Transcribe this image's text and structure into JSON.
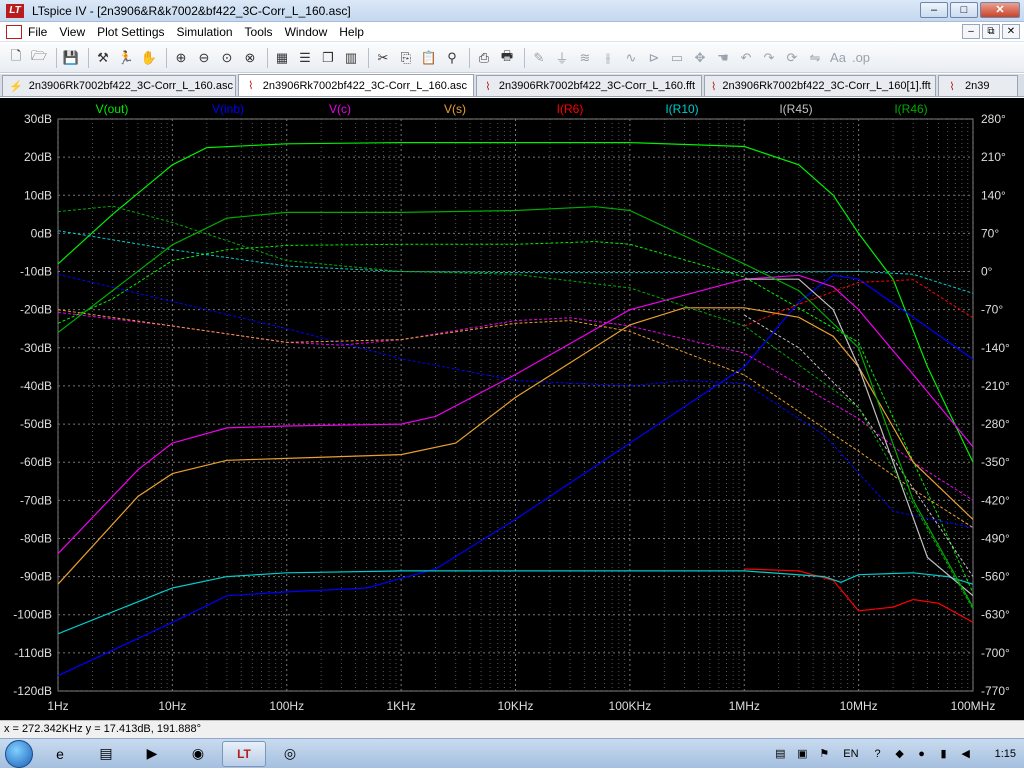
{
  "window": {
    "app_name": "LTspice IV",
    "document": "[2n3906&R&k7002&bf422_3C-Corr_L_160.asc]",
    "logo_text": "LT",
    "minimize": "–",
    "maximize": "□",
    "close": "✕"
  },
  "menu": {
    "items": [
      "File",
      "View",
      "Plot Settings",
      "Simulation",
      "Tools",
      "Window",
      "Help"
    ],
    "mdi_min": "–",
    "mdi_restore": "⧉",
    "mdi_close": "✕"
  },
  "toolbar": {
    "icons": [
      "open-icon",
      "open-folder-icon",
      "save-icon",
      "control-panel-icon",
      "run-icon",
      "halt-icon",
      "zoom-in-icon",
      "zoom-out-icon",
      "zoom-fit-icon",
      "zoom-cancel-icon",
      "autorange-icon",
      "tile-horizontal-icon",
      "cascade-icon",
      "tile-vertical-icon",
      "cut-icon",
      "copy-icon",
      "paste-icon",
      "find-icon",
      "print-setup-icon",
      "print-icon",
      "draw-wire-icon",
      "ground-icon",
      "resistor-icon",
      "capacitor-icon",
      "inductor-icon",
      "diode-icon",
      "component-icon",
      "move-icon",
      "drag-icon",
      "undo-icon",
      "redo-icon",
      "rotate-icon",
      "mirror-icon",
      "text-icon",
      "spice-directive-icon"
    ]
  },
  "tabs": [
    {
      "label": "2n3906Rk7002bf422_3C-Corr_L_160.asc",
      "icon": "schematic-icon",
      "active": false
    },
    {
      "label": "2n3906Rk7002bf422_3C-Corr_L_160.asc",
      "icon": "waveform-icon",
      "active": true
    },
    {
      "label": "2n3906Rk7002bf422_3C-Corr_L_160.fft",
      "icon": "waveform-icon",
      "active": false
    },
    {
      "label": "2n3906Rk7002bf422_3C-Corr_L_160[1].fft",
      "icon": "waveform-icon",
      "active": false
    },
    {
      "label": "2n39",
      "icon": "waveform-icon",
      "active": false
    }
  ],
  "chart_data": {
    "type": "line",
    "x_scale": "log",
    "x_ticks": [
      "1Hz",
      "10Hz",
      "100Hz",
      "1KHz",
      "10KHz",
      "100KHz",
      "1MHz",
      "10MHz",
      "100MHz"
    ],
    "xlim": [
      1,
      100000000
    ],
    "y_left_ticks": [
      "30dB",
      "20dB",
      "10dB",
      "0dB",
      "-10dB",
      "-20dB",
      "-30dB",
      "-40dB",
      "-50dB",
      "-60dB",
      "-70dB",
      "-80dB",
      "-90dB",
      "-100dB",
      "-110dB",
      "-120dB"
    ],
    "ylim_left": [
      -120,
      30
    ],
    "y_right_ticks": [
      "280°",
      "210°",
      "140°",
      "70°",
      "0°",
      "-70°",
      "-140°",
      "-210°",
      "-280°",
      "-350°",
      "-420°",
      "-490°",
      "-560°",
      "-630°",
      "-700°",
      "-770°"
    ],
    "ylim_right": [
      -770,
      280
    ],
    "grid": true,
    "series": [
      {
        "name": "V(out)",
        "color": "#00ee00",
        "mag": [
          [
            1,
            -8
          ],
          [
            3,
            5
          ],
          [
            10,
            18
          ],
          [
            20,
            22.5
          ],
          [
            100,
            23.5
          ],
          [
            1000,
            23.8
          ],
          [
            100000,
            23.8
          ],
          [
            1000000,
            22.8
          ],
          [
            3000000,
            18
          ],
          [
            6000000,
            10
          ],
          [
            10000000,
            0
          ],
          [
            20000000,
            -12
          ],
          [
            40000000,
            -35
          ],
          [
            100000000,
            -60
          ]
        ],
        "phase": [
          [
            1,
            -95
          ],
          [
            3,
            -50
          ],
          [
            10,
            20
          ],
          [
            30,
            40
          ],
          [
            100,
            48
          ],
          [
            1000,
            50
          ],
          [
            10000,
            50
          ],
          [
            50000,
            55
          ],
          [
            100000,
            50
          ],
          [
            1000000,
            -10
          ],
          [
            10000000,
            -130
          ],
          [
            50000000,
            -450
          ],
          [
            100000000,
            -590
          ]
        ]
      },
      {
        "name": "V(inb)",
        "color": "#0000ff",
        "mag": [
          [
            1,
            -116
          ],
          [
            10,
            -102
          ],
          [
            30,
            -95
          ],
          [
            100,
            -94
          ],
          [
            500,
            -93
          ],
          [
            2000,
            -88
          ],
          [
            10000,
            -75
          ],
          [
            100000,
            -55
          ],
          [
            1000000,
            -35
          ],
          [
            3000000,
            -18
          ],
          [
            6000000,
            -11
          ],
          [
            10000000,
            -12
          ],
          [
            30000000,
            -22
          ],
          [
            100000000,
            -33
          ]
        ],
        "phase": [
          [
            1,
            -5
          ],
          [
            10,
            -55
          ],
          [
            100,
            -105
          ],
          [
            1000,
            -160
          ],
          [
            10000,
            -200
          ],
          [
            100000,
            -210
          ],
          [
            300000,
            -200
          ],
          [
            1000000,
            -205
          ],
          [
            5000000,
            -300
          ],
          [
            20000000,
            -440
          ],
          [
            100000000,
            -470
          ]
        ]
      },
      {
        "name": "V(c)",
        "color": "#ee00ee",
        "mag": [
          [
            1,
            -84
          ],
          [
            5,
            -62
          ],
          [
            10,
            -55
          ],
          [
            30,
            -51
          ],
          [
            100,
            -50.5
          ],
          [
            1000,
            -50
          ],
          [
            2000,
            -48
          ],
          [
            10000,
            -37
          ],
          [
            100000,
            -20
          ],
          [
            1000000,
            -12
          ],
          [
            3000000,
            -11
          ],
          [
            6000000,
            -14
          ],
          [
            10000000,
            -20
          ],
          [
            30000000,
            -37
          ],
          [
            100000000,
            -56
          ]
        ],
        "phase": [
          [
            1,
            -75
          ],
          [
            10,
            -100
          ],
          [
            100,
            -130
          ],
          [
            300,
            -135
          ],
          [
            1000,
            -125
          ],
          [
            10000,
            -90
          ],
          [
            30000,
            -85
          ],
          [
            100000,
            -100
          ],
          [
            1000000,
            -150
          ],
          [
            10000000,
            -270
          ],
          [
            30000000,
            -350
          ],
          [
            100000000,
            -420
          ]
        ]
      },
      {
        "name": "V(s)",
        "color": "#e8a030",
        "mag": [
          [
            1,
            -92
          ],
          [
            5,
            -69
          ],
          [
            10,
            -63
          ],
          [
            30,
            -59.5
          ],
          [
            100,
            -59
          ],
          [
            1000,
            -58
          ],
          [
            3000,
            -55
          ],
          [
            10000,
            -43
          ],
          [
            100000,
            -24
          ],
          [
            300000,
            -19.5
          ],
          [
            1000000,
            -19.5
          ],
          [
            3000000,
            -22
          ],
          [
            6000000,
            -27
          ],
          [
            10000000,
            -35
          ],
          [
            30000000,
            -60
          ],
          [
            100000000,
            -75
          ]
        ],
        "phase": [
          [
            1,
            -70
          ],
          [
            10,
            -100
          ],
          [
            100,
            -130
          ],
          [
            1000,
            -125
          ],
          [
            10000,
            -95
          ],
          [
            30000,
            -90
          ],
          [
            100000,
            -110
          ],
          [
            1000000,
            -190
          ],
          [
            10000000,
            -330
          ],
          [
            30000000,
            -400
          ],
          [
            100000000,
            -470
          ]
        ]
      },
      {
        "name": "I(R6)",
        "color": "#ff0000",
        "mag": [
          [
            1000000,
            -88
          ],
          [
            3000000,
            -88.5
          ],
          [
            6000000,
            -91
          ],
          [
            10000000,
            -99
          ],
          [
            20000000,
            -98
          ],
          [
            30000000,
            -96
          ],
          [
            50000000,
            -97
          ],
          [
            100000000,
            -102
          ]
        ],
        "phase": [
          [
            1000000,
            -100
          ],
          [
            3000000,
            -60
          ],
          [
            10000000,
            -20
          ],
          [
            30000000,
            -15
          ],
          [
            100000000,
            -85
          ]
        ]
      },
      {
        "name": "I(R10)",
        "color": "#00cccc",
        "mag": [
          [
            1,
            -105
          ],
          [
            10,
            -93
          ],
          [
            30,
            -90
          ],
          [
            100,
            -89
          ],
          [
            1000,
            -88.5
          ],
          [
            10000,
            -88.5
          ],
          [
            100000,
            -88.5
          ],
          [
            1000000,
            -88.5
          ],
          [
            5000000,
            -90
          ],
          [
            7000000,
            -91.5
          ],
          [
            10000000,
            -89.5
          ],
          [
            30000000,
            -89
          ],
          [
            60000000,
            -90
          ],
          [
            100000000,
            -92
          ]
        ],
        "phase": [
          [
            1,
            75
          ],
          [
            10,
            40
          ],
          [
            100,
            10
          ],
          [
            1000,
            0
          ],
          [
            10000,
            -2
          ],
          [
            100000,
            -2
          ],
          [
            1000000,
            -2
          ],
          [
            10000000,
            0
          ],
          [
            30000000,
            -5
          ],
          [
            100000000,
            -40
          ]
        ]
      },
      {
        "name": "I(R45)",
        "color": "#c0c0c0",
        "mag": [
          [
            1000000,
            -12
          ],
          [
            3000000,
            -12
          ],
          [
            6000000,
            -20
          ],
          [
            10000000,
            -35
          ],
          [
            20000000,
            -60
          ],
          [
            40000000,
            -85
          ],
          [
            100000000,
            -95
          ]
        ],
        "phase": [
          [
            1000000,
            -80
          ],
          [
            3000000,
            -140
          ],
          [
            10000000,
            -250
          ],
          [
            100000000,
            -560
          ]
        ]
      },
      {
        "name": "I(R46)",
        "color": "#00aa00",
        "mag": [
          [
            1,
            -26
          ],
          [
            3,
            -15
          ],
          [
            10,
            -3
          ],
          [
            30,
            4
          ],
          [
            100,
            5.5
          ],
          [
            1000,
            5.5
          ],
          [
            10000,
            6
          ],
          [
            50000,
            7
          ],
          [
            100000,
            6
          ],
          [
            1000000,
            -8
          ],
          [
            3000000,
            -15
          ],
          [
            10000000,
            -30
          ],
          [
            30000000,
            -70
          ],
          [
            100000000,
            -98
          ]
        ],
        "phase": [
          [
            1,
            110
          ],
          [
            3,
            120
          ],
          [
            10,
            90
          ],
          [
            100,
            20
          ],
          [
            1000,
            0
          ],
          [
            10000,
            -5
          ],
          [
            100000,
            -30
          ],
          [
            1000000,
            -100
          ],
          [
            10000000,
            -250
          ],
          [
            100000000,
            -620
          ]
        ]
      }
    ]
  },
  "status": {
    "cursor": "x = 272.342KHz    y = 17.413dB, 191.888°"
  },
  "taskbar": {
    "apps": [
      {
        "name": "ie-icon",
        "glyph": "e",
        "active": false
      },
      {
        "name": "explorer-icon",
        "glyph": "▤",
        "active": false
      },
      {
        "name": "media-player-icon",
        "glyph": "▶",
        "active": false
      },
      {
        "name": "firefox-icon",
        "glyph": "◉",
        "active": false
      },
      {
        "name": "ltspice-icon",
        "glyph": "LT",
        "active": true
      },
      {
        "name": "app-icon",
        "glyph": "◎",
        "active": false
      }
    ],
    "language": "EN",
    "clock": "1:15"
  }
}
